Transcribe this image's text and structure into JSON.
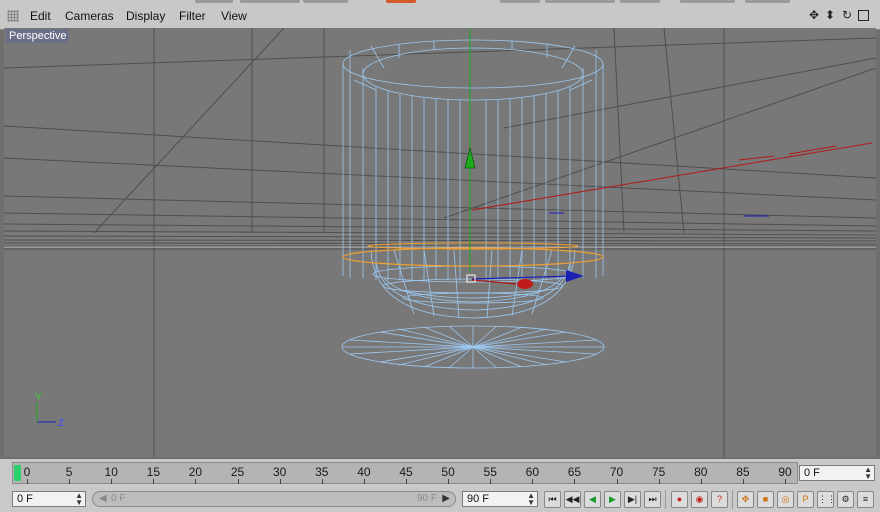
{
  "menu": {
    "edit": "Edit",
    "cameras": "Cameras",
    "display": "Display",
    "filter": "Filter",
    "view": "View"
  },
  "nav_icons": [
    "move-view-icon",
    "dolly-view-icon",
    "rotate-view-icon",
    "maximize-view-icon"
  ],
  "viewport": {
    "label": "Perspective",
    "axis_labels": {
      "y": "Y",
      "z": "Z"
    }
  },
  "timeline": {
    "ticks": [
      "0",
      "5",
      "10",
      "15",
      "20",
      "25",
      "30",
      "35",
      "40",
      "45",
      "50",
      "55",
      "60",
      "65",
      "70",
      "75",
      "80",
      "85",
      "90"
    ],
    "current_frame": "0 F"
  },
  "bottom": {
    "start_field": "0 F",
    "range_start": "0 F",
    "range_end": "90 F",
    "end_field": "90 F"
  },
  "transport": [
    "go-to-start",
    "prev-key",
    "prev-frame",
    "play-backward",
    "play-forward",
    "next-frame",
    "next-key",
    "go-to-end"
  ],
  "record": [
    "record-keys",
    "autokey",
    "keyframe-selection"
  ],
  "colors": {
    "wire": "#9cc9f2",
    "selection": "#f0a030",
    "x_axis": "#b21818",
    "y_axis": "#1dac1d",
    "z_axis": "#1a1fb5",
    "playhead": "#2bd16b"
  }
}
